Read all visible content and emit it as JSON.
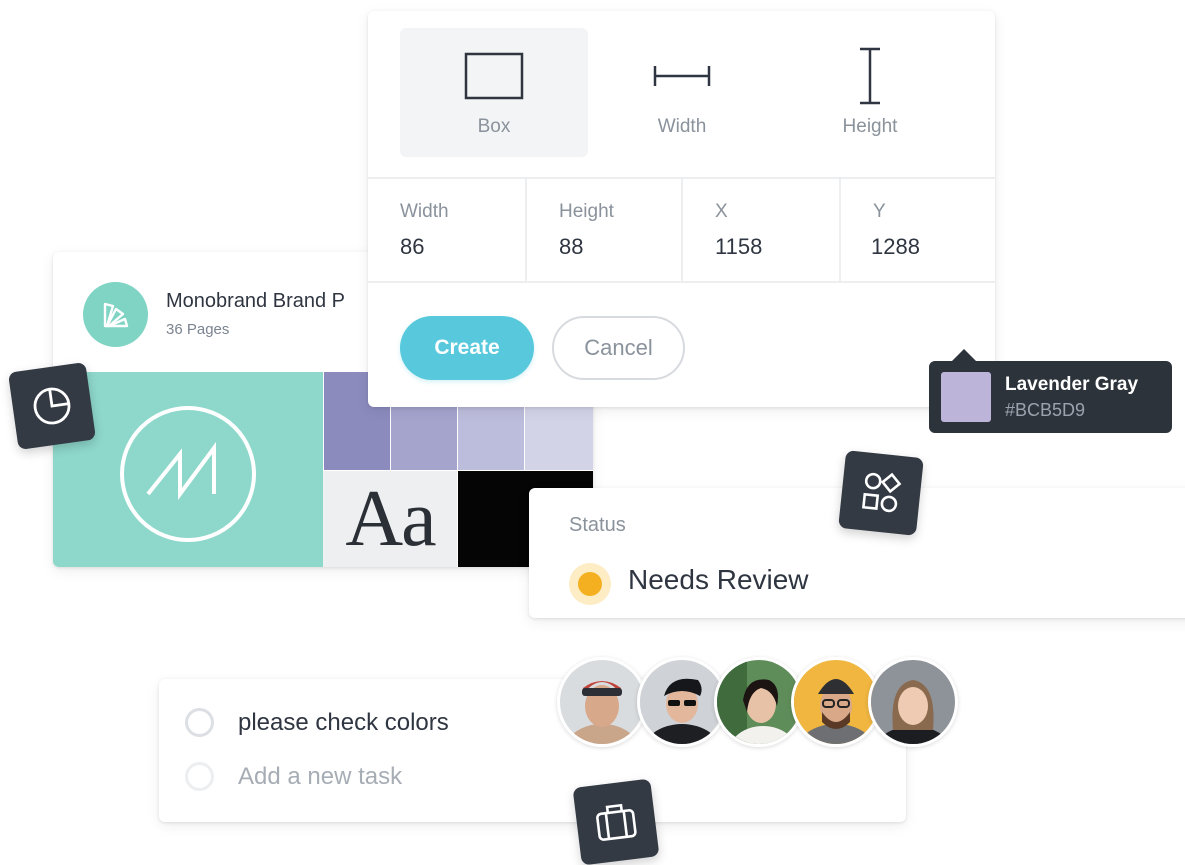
{
  "brand_card": {
    "title": "Monobrand Brand P",
    "subtitle": "36 Pages",
    "icon": "palette-fan-icon",
    "logo": "monogram-m-icon",
    "typeface_sample": "Aa",
    "colors": {
      "teal": "#8ED8CB",
      "swatches": [
        "#8C8BBE",
        "#A4A4CD",
        "#BCBCDC",
        "#D3D3E8"
      ]
    }
  },
  "dimension_dialog": {
    "modes": [
      {
        "label": "Box",
        "icon": "box-icon",
        "active": true
      },
      {
        "label": "Width",
        "icon": "width-icon",
        "active": false
      },
      {
        "label": "Height",
        "icon": "height-icon",
        "active": false
      }
    ],
    "fields": [
      {
        "label": "Width",
        "value": "86"
      },
      {
        "label": "Height",
        "value": "88"
      },
      {
        "label": "X",
        "value": "1158"
      },
      {
        "label": "Y",
        "value": "1288"
      }
    ],
    "create_label": "Create",
    "cancel_label": "Cancel",
    "accent": "#58C9DC"
  },
  "color_tooltip": {
    "name": "Lavender Gray",
    "hex": "#BCB5D9",
    "swatch_color": "#BCB5D9"
  },
  "status_card": {
    "label": "Status",
    "value": "Needs Review",
    "dot_color": "#F4B021"
  },
  "task_card": {
    "tasks": [
      {
        "text": "please check colors",
        "done": false
      }
    ],
    "new_task_placeholder": "Add a new task"
  },
  "avatars": [
    {
      "name": "avatar-1"
    },
    {
      "name": "avatar-2"
    },
    {
      "name": "avatar-3"
    },
    {
      "name": "avatar-4"
    },
    {
      "name": "avatar-5"
    }
  ],
  "floating_tiles": [
    {
      "icon": "pie-chart-icon"
    },
    {
      "icon": "shapes-icon"
    },
    {
      "icon": "briefcase-icon"
    }
  ]
}
